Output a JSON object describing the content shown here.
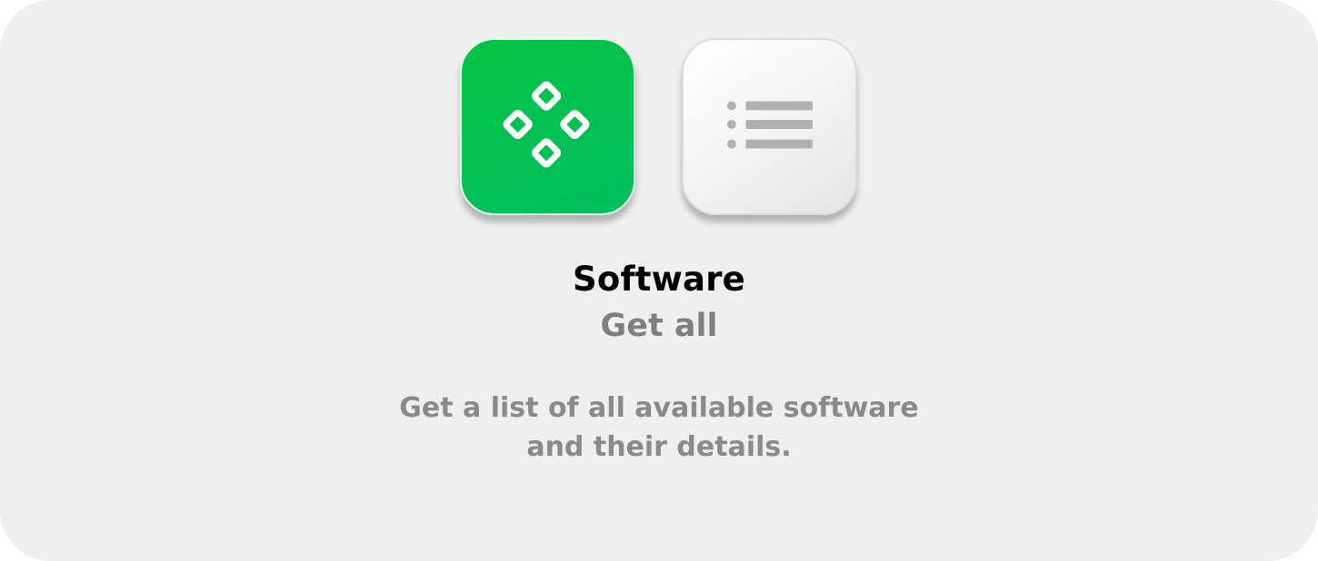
{
  "app": {
    "name": "Software",
    "icon": "diamond-grid-icon",
    "color": "#04c444"
  },
  "action": {
    "name": "Get all",
    "icon": "list-icon",
    "description": "Get a list of all available software and their details."
  },
  "colors": {
    "background": "#efefef",
    "title": "#000000",
    "subtitle": "#7f7f7f",
    "description": "#8a8a8a",
    "list_icon": "#b0b0b0"
  }
}
